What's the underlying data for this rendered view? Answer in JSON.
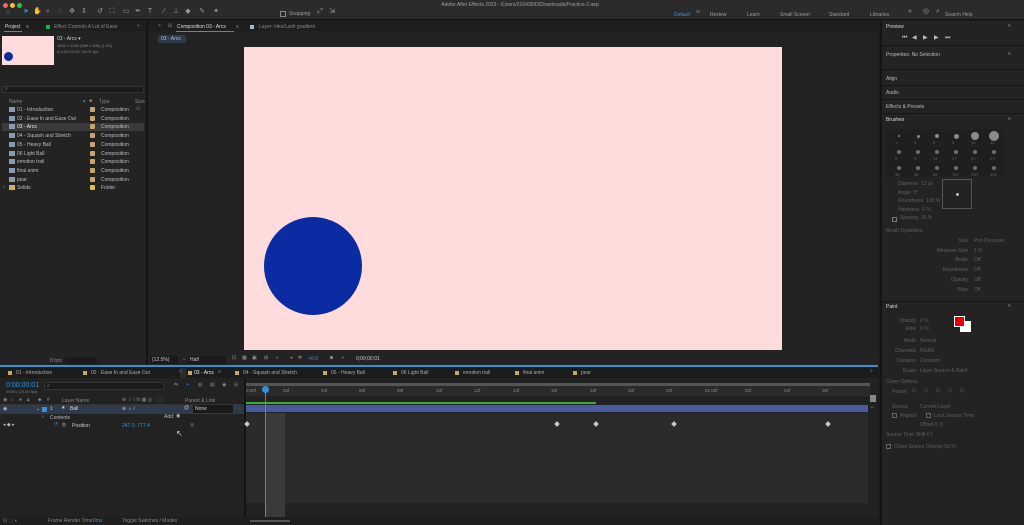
{
  "app": {
    "title": "Adobe After Effects 2023 - /Users/21643693/Downloads/Practice-2.aep",
    "snapping_label": "Snapping",
    "workspaces": [
      "Default",
      "Review",
      "Learn",
      "Small Screen",
      "Standard",
      "Libraries"
    ],
    "search_placeholder": "Search Help"
  },
  "project_panel": {
    "tab_project": "Project",
    "tab_effect_controls": "Effect Controls A Lot of Ease",
    "selected_name": "03 - Arcs ▾",
    "selected_info_1": "1920 x 1080  (960 x 540) (1.00)",
    "selected_info_2": "Δ 0;00;03;00, 24.00 fps",
    "col_name": "Name",
    "col_type": "Type",
    "col_size": "Size",
    "items": [
      {
        "name": "01 - Introduction",
        "type": "Composition"
      },
      {
        "name": "02 - Ease In and Ease Out",
        "type": "Composition"
      },
      {
        "name": "03 - Arcs",
        "type": "Composition"
      },
      {
        "name": "04 - Squash and Stretch",
        "type": "Composition"
      },
      {
        "name": "05 - Heavy Ball",
        "type": "Composition"
      },
      {
        "name": "06 Light Ball",
        "type": "Composition"
      },
      {
        "name": "emotion trail",
        "type": "Composition"
      },
      {
        "name": "final anim",
        "type": "Composition"
      },
      {
        "name": "pear",
        "type": "Composition"
      },
      {
        "name": "Solids",
        "type": "Folder"
      }
    ],
    "bpc": "8 bpc"
  },
  "comp_panel": {
    "tab_label": "Composition 03 - Arcs",
    "layer_tab": "Layer: inks/Lash gradient",
    "breadcrumb": "03 - Arcs",
    "zoom": "(12.5%)",
    "resolution": "Half",
    "exposure": "+0.0",
    "timecode": "0;00;00;01"
  },
  "right_panel": {
    "preview": "Preview",
    "properties": "Properties: No Selection",
    "sections": [
      "Align",
      "Audio",
      "Effects & Presets",
      "Brushes"
    ],
    "brush_sizes": [
      "1",
      "3",
      "5",
      "9",
      "13",
      "19",
      "5",
      "9",
      "13",
      "17",
      "21",
      "27",
      "35",
      "45",
      "65",
      "100",
      "200",
      "300"
    ],
    "brush_fields": [
      {
        "label": "Diameter",
        "value": "13 px"
      },
      {
        "label": "Angle",
        "value": "0°"
      },
      {
        "label": "Roundness",
        "value": "100 %"
      },
      {
        "label": "Hardness",
        "value": "0 %"
      },
      {
        "label": "Spacing",
        "value": "25 %"
      }
    ],
    "brush_dynamics": "Brush Dynamics",
    "dyn_fields": [
      {
        "label": "Size",
        "value": "Pen Pressure"
      },
      {
        "label": "Minimum Size",
        "value": "1 %"
      },
      {
        "label": "Angle",
        "value": "Off"
      },
      {
        "label": "Roundness",
        "value": "Off"
      },
      {
        "label": "Opacity",
        "value": "Off"
      },
      {
        "label": "Flow",
        "value": "Off"
      }
    ],
    "paint": "Paint",
    "paint_fields": [
      {
        "label": "Opacity",
        "value": "0 %"
      },
      {
        "label": "Flow",
        "value": "1 %"
      },
      {
        "label": "Mode",
        "value": "Normal"
      },
      {
        "label": "Channels",
        "value": "RGBA"
      },
      {
        "label": "Duration",
        "value": "Constant"
      },
      {
        "label": "Erase",
        "value": "Layer Source & Paint"
      }
    ],
    "clone_options": "Clone Options",
    "preset": "Preset",
    "source": "Source",
    "source_value": "Current Layer",
    "aligned": "Aligned",
    "lock_source_time": "Lock Source Time",
    "offset": "Offset  0, 0",
    "source_time_shift": "Source Time Shift  0 f",
    "clone_overlay": "Clone Source Overlay  50 %",
    "fg_color": "#e00000",
    "bg_color": "#ffffff"
  },
  "timeline": {
    "tabs": [
      "01 - Introduction",
      "02 - Ease In and Ease Out",
      "03 - Arcs",
      "04 - Squash and Stretch",
      "05 - Heavy Ball",
      "06 Light Ball",
      "emotion trail",
      "final anim",
      "pear"
    ],
    "timecode": "0:00:00:01",
    "fps_info": "00001 (24.00 fps)",
    "col_layer_name": "Layer Name",
    "col_parent": "Parent & Link",
    "layer_number": "1",
    "layer_name": "Ball",
    "parent_value": "None",
    "contents": "Contents",
    "add_label": "Add:",
    "position_label": "Position",
    "position_value": "247.0, 777.4",
    "ruler": [
      "0:00f",
      "02f",
      "04f",
      "06f",
      "08f",
      "10f",
      "12f",
      "14f",
      "16f",
      "18f",
      "20f",
      "22f",
      "01:00f",
      "02f",
      "04f",
      "06f"
    ],
    "footer_render_label": "Frame Render Time:",
    "footer_render_value": "0ms",
    "footer_toggle": "Toggle Switches / Modes"
  },
  "colors": {
    "canvas": "#ffdcdc",
    "ball": "#0b2ba3",
    "accent": "#3b8fd9"
  }
}
